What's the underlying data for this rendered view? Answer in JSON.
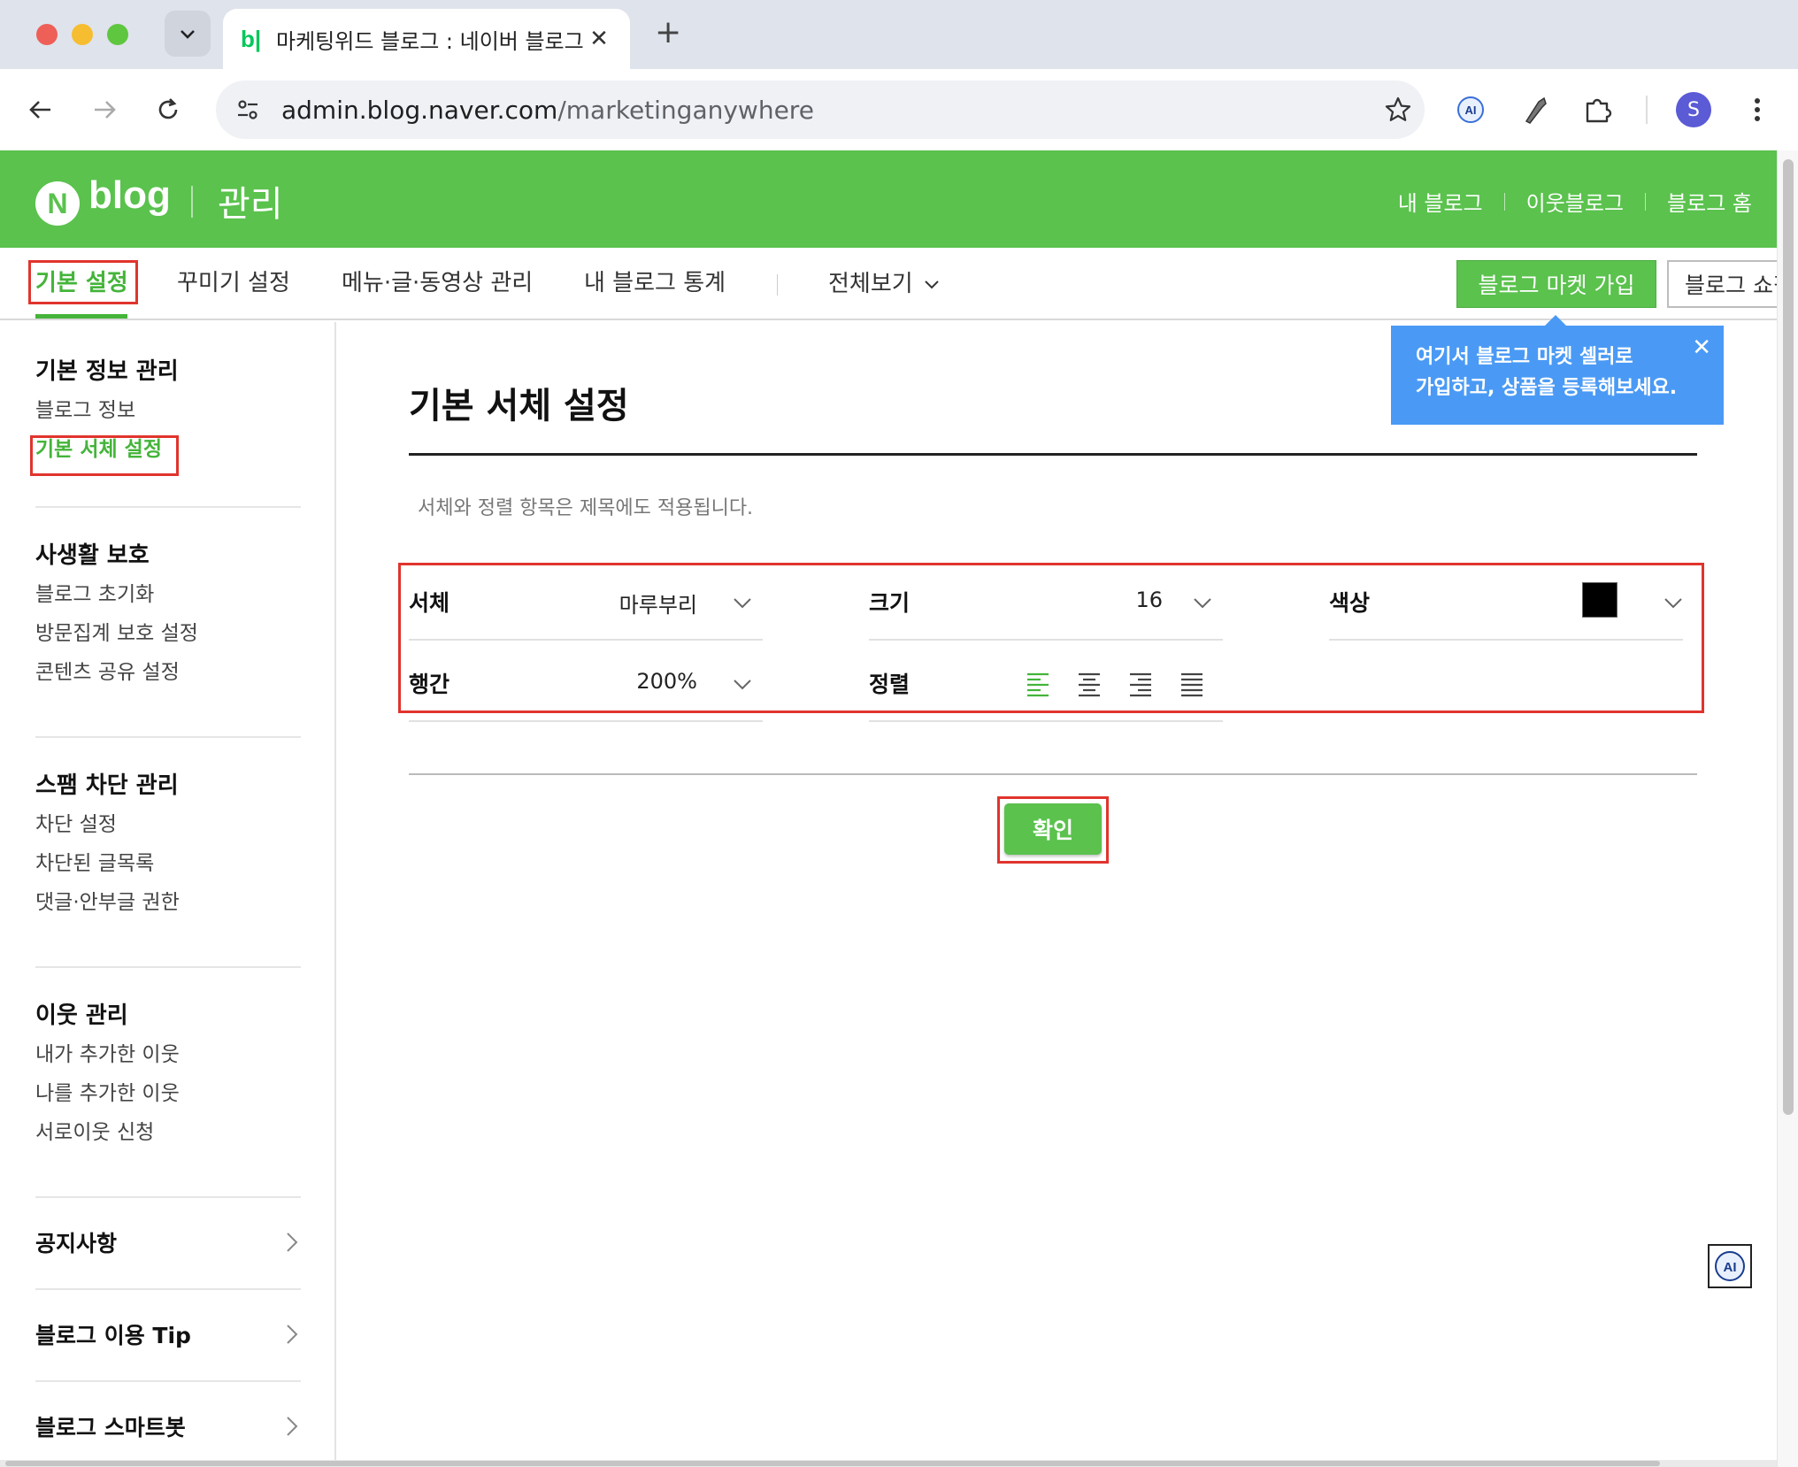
{
  "browser": {
    "tab": {
      "favicon_text": "b|",
      "title": "마케팅위드 블로그 : 네이버 블로그",
      "close_glyph": "✕"
    },
    "new_tab_glyph": "+",
    "url_host": "admin.blog.naver.com",
    "url_path": "/marketinganywhere",
    "profile_initial": "S"
  },
  "header": {
    "logo_n": "N",
    "logo_blog": "blog",
    "section": "관리",
    "links": [
      "내 블로그",
      "이웃블로그",
      "블로그 홈"
    ]
  },
  "gnb": {
    "items": [
      "기본 설정",
      "꾸미기 설정",
      "메뉴·글·동영상 관리",
      "내 블로그 통계"
    ],
    "all_view": "전체보기",
    "market_button": "블로그 마켓 가입",
    "shop_button": "블로그 쇼핑"
  },
  "tooltip": {
    "line1": "여기서 블로그 마켓 셀러로",
    "line2": "가입하고, 상품을 등록해보세요.",
    "close": "✕"
  },
  "sidebar": {
    "sections": [
      {
        "title": "기본 정보 관리",
        "items": [
          "블로그 정보",
          "기본 서체 설정"
        ]
      },
      {
        "title": "사생활 보호",
        "items": [
          "블로그 초기화",
          "방문집계 보호 설정",
          "콘텐츠 공유 설정"
        ]
      },
      {
        "title": "스팸 차단 관리",
        "items": [
          "차단 설정",
          "차단된 글목록",
          "댓글·안부글 권한"
        ]
      },
      {
        "title": "이웃 관리",
        "items": [
          "내가 추가한 이웃",
          "나를 추가한 이웃",
          "서로이웃 신청"
        ]
      }
    ],
    "links": [
      "공지사항",
      "블로그 이용 Tip",
      "블로그 스마트봇"
    ]
  },
  "main": {
    "title": "기본 서체 설정",
    "description": "서체와 정렬 항목은 제목에도 적용됩니다.",
    "font_label": "서체",
    "font_value": "마루부리",
    "size_label": "크기",
    "size_value": "16",
    "color_label": "색상",
    "color_value": "#000000",
    "line_label": "행간",
    "line_value": "200%",
    "align_label": "정렬",
    "align_selected": "left",
    "confirm": "확인"
  },
  "colors": {
    "brand_green": "#5ac24d",
    "active_green": "#44b43a",
    "tooltip_blue": "#4a9af5",
    "highlight_red": "#e0342d"
  },
  "floating": {
    "ai_badge": "AI"
  }
}
